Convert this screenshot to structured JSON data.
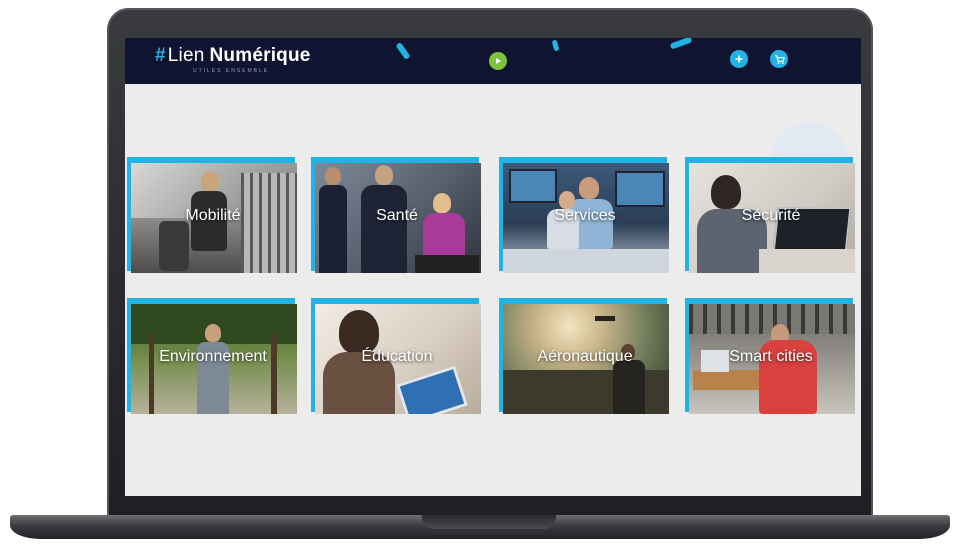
{
  "brand": {
    "hash": "#",
    "lien": "Lien",
    "numerique": "Numérique",
    "tagline": "utiles ensemble"
  },
  "header": {
    "play_icon": "play-icon",
    "add_icon": "plus-icon",
    "cart_icon": "cart-icon"
  },
  "categories": [
    {
      "label": "Mobilité"
    },
    {
      "label": "Santé"
    },
    {
      "label": "Services"
    },
    {
      "label": "Sécurité"
    },
    {
      "label": "Environnement"
    },
    {
      "label": "Éducation"
    },
    {
      "label": "Aéronautique"
    },
    {
      "label": "Smart cities"
    }
  ],
  "colors": {
    "header_bg": "#0f1430",
    "accent": "#21b3e6",
    "play": "#7ec13b",
    "screen_bg": "#ececed"
  }
}
